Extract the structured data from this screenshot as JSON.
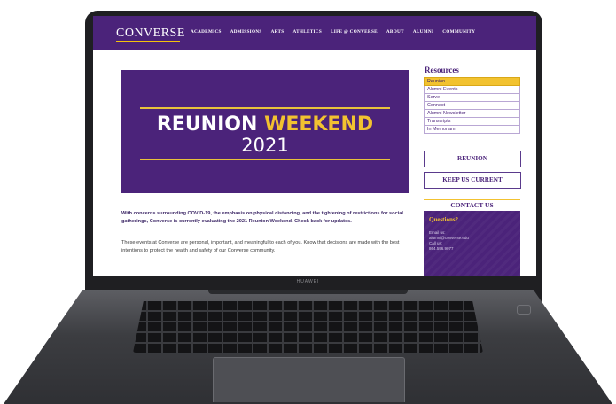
{
  "device": {
    "brand": "HUAWEI"
  },
  "site": {
    "logo": "CONVERSE",
    "nav": [
      "ACADEMICS",
      "ADMISSIONS",
      "ARTS",
      "ATHLETICS",
      "LIFE @ CONVERSE",
      "ABOUT",
      "ALUMNI",
      "COMMUNITY"
    ]
  },
  "hero": {
    "title_white": "REUNION",
    "title_gold": "WEEKEND",
    "year": "2021",
    "accent_gold": "#f2c230",
    "background": "#4b237a"
  },
  "content": {
    "bold_paragraph": "With concerns surrounding COVID-19, the emphasis on physical distancing, and the tightening of restrictions for social gatherings, Converse is currently evaluating the 2021 Reunion Weekend. Check back for updates.",
    "paragraph": "These events at Converse are personal, important, and meaningful to each of you. Know that decisions are made with the best intentions to protect the health and safety of our Converse community."
  },
  "sidebar": {
    "resources_title": "Resources",
    "resources": [
      "Reunion",
      "Alumni Events",
      "Serve",
      "Connect",
      "Alumni Newsletter",
      "Transcripts",
      "In Memoriam"
    ],
    "reunion_button": "REUNION",
    "keep_current_button": "KEEP US CURRENT",
    "contact_title": "CONTACT US",
    "questions_title": "Questions?",
    "email_label": "Email us:",
    "email": "alumni@converse.edu",
    "call_label": "Call us:",
    "phone": "864.596.9077"
  }
}
